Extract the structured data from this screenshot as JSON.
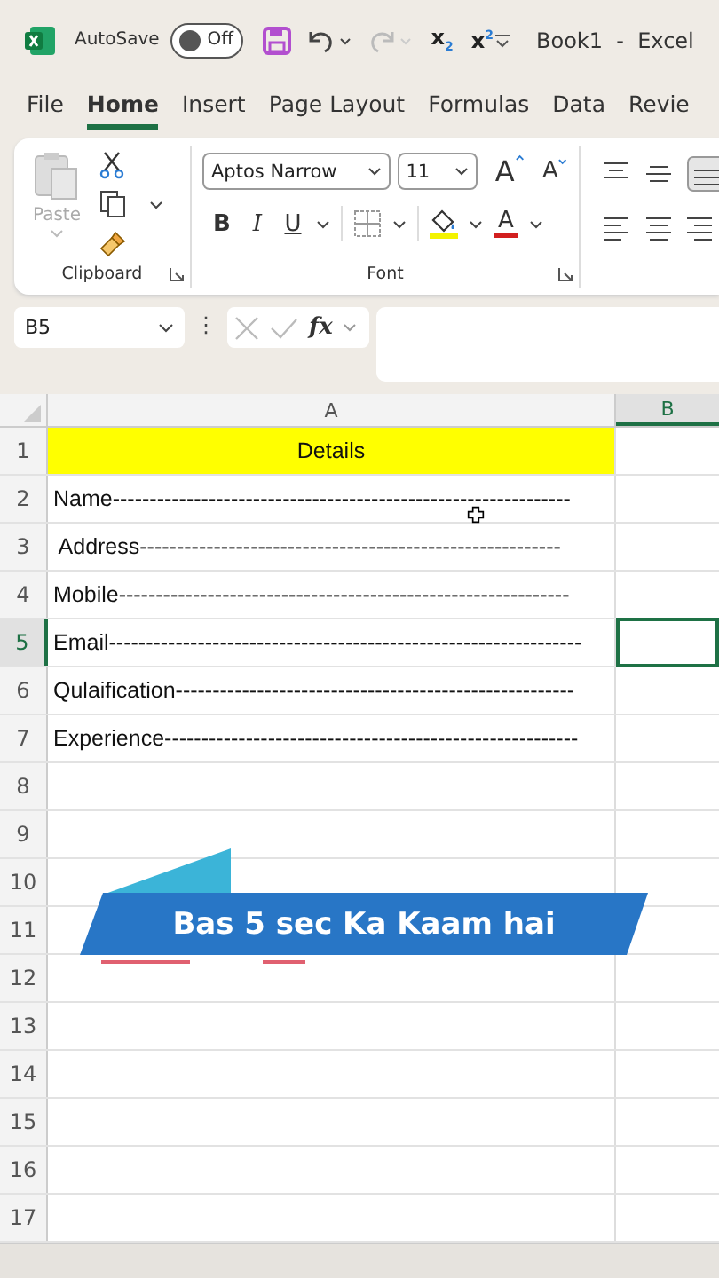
{
  "title_bar": {
    "autosave_label": "AutoSave",
    "autosave": {
      "on": false,
      "label": "Off"
    },
    "quick_access": [
      {
        "text": "x$_{2}$"
      },
      {
        "text": "x$^{2}$"
      }
    ],
    "title": "Book1  -  Excel"
  },
  "tabs": [
    {
      "label": "File",
      "selected": false
    },
    {
      "label": "Home",
      "selected": true
    },
    {
      "label": "Insert",
      "selected": false
    },
    {
      "label": "Page Layout",
      "selected": false
    },
    {
      "label": "Formulas",
      "selected": false
    },
    {
      "label": "Data",
      "selected": false
    },
    {
      "label": "Revie",
      "selected": false
    }
  ],
  "ribbon": {
    "clipboard": {
      "paste_label": "Paste",
      "paste_disabled": true,
      "group_label": "Clipboard"
    },
    "font": {
      "font_name": "Aptos Narrow",
      "font_size": "11",
      "grow": "A",
      "shrink": "A",
      "bold": "B",
      "italic": "I",
      "underline": "U",
      "font_color": "A",
      "group_label": "Font"
    }
  },
  "formula_bar": {
    "name_box": "B5",
    "more": "⋮",
    "fx": "fx"
  },
  "sheet": {
    "columns": [
      {
        "label": "A",
        "selected": false
      },
      {
        "label": "B",
        "selected": true
      }
    ],
    "rows": [
      {
        "number": "1",
        "selected": false,
        "cell_a": "Details",
        "highlighted": true,
        "b_selected": false
      },
      {
        "number": "2",
        "selected": false,
        "cell_a": "Name--------------------------------------------------------------",
        "highlighted": false,
        "b_selected": false
      },
      {
        "number": "3",
        "selected": false,
        "cell_a": " Address---------------------------------------------------------",
        "highlighted": false,
        "b_selected": false
      },
      {
        "number": "4",
        "selected": false,
        "cell_a": "Mobile-------------------------------------------------------------",
        "highlighted": false,
        "b_selected": false
      },
      {
        "number": "5",
        "selected": true,
        "cell_a": "Email----------------------------------------------------------------",
        "highlighted": false,
        "b_selected": true
      },
      {
        "number": "6",
        "selected": false,
        "cell_a": "Qulaification------------------------------------------------------",
        "highlighted": false,
        "b_selected": false
      },
      {
        "number": "7",
        "selected": false,
        "cell_a": "Experience--------------------------------------------------------",
        "highlighted": false,
        "b_selected": false
      },
      {
        "number": "8",
        "selected": false,
        "highlighted": false,
        "b_selected": false
      },
      {
        "number": "9",
        "selected": false,
        "highlighted": false,
        "b_selected": false
      },
      {
        "number": "10",
        "selected": false,
        "highlighted": false,
        "b_selected": false
      },
      {
        "number": "11",
        "selected": false,
        "highlighted": false,
        "b_selected": false
      },
      {
        "number": "12",
        "selected": false,
        "highlighted": false,
        "b_selected": false
      },
      {
        "number": "13",
        "selected": false,
        "highlighted": false,
        "b_selected": false
      },
      {
        "number": "14",
        "selected": false,
        "highlighted": false,
        "b_selected": false
      },
      {
        "number": "15",
        "selected": false,
        "highlighted": false,
        "b_selected": false
      },
      {
        "number": "16",
        "selected": false,
        "highlighted": false,
        "b_selected": false
      },
      {
        "number": "17",
        "selected": false,
        "highlighted": false,
        "b_selected": false
      }
    ]
  },
  "banner": {
    "text": "Bas 5 sec Ka Kaam hai"
  }
}
